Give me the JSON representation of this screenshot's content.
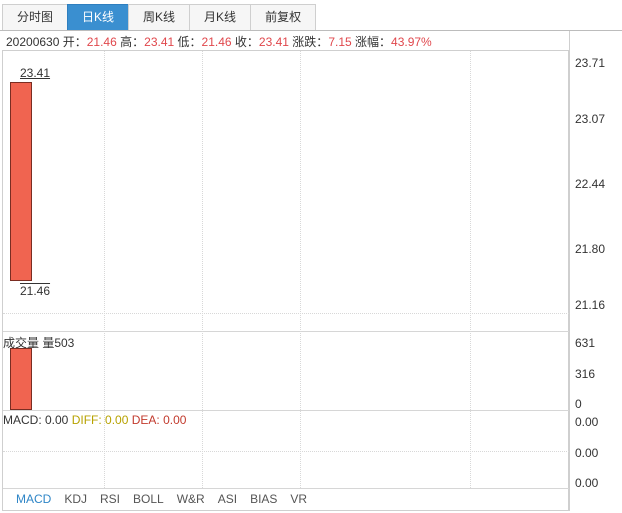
{
  "tabs": [
    "分时图",
    "日K线",
    "周K线",
    "月K线",
    "前复权"
  ],
  "active_tab_index": 1,
  "info": {
    "date": "20200630",
    "open_label": "开：",
    "open": "21.46",
    "high_label": "高：",
    "high": "23.41",
    "low_label": "低：",
    "low": "21.46",
    "close_label": "收：",
    "close": "23.41",
    "change_label": "涨跌：",
    "change": "7.15",
    "pct_label": "涨幅：",
    "pct": "43.97%"
  },
  "candle": {
    "high_label": "23.41",
    "low_label": "21.46"
  },
  "price_axis": [
    "23.71",
    "23.07",
    "22.44",
    "21.80",
    "21.16"
  ],
  "volume": {
    "title": "成交量 量503",
    "axis": [
      "631",
      "316",
      "0"
    ]
  },
  "macd": {
    "macd_text": "MACD: 0.00",
    "diff_text": "DIFF: 0.00",
    "dea_text": "DEA: 0.00",
    "axis": [
      "0.00",
      "0.00",
      "0.00"
    ]
  },
  "indicator_tabs": [
    "MACD",
    "KDJ",
    "RSI",
    "BOLL",
    "W&R",
    "ASI",
    "BIAS",
    "VR"
  ],
  "active_indicator_index": 0,
  "colors": {
    "up": "#f06450",
    "accent": "#3a8fd0",
    "diff": "#b7a200",
    "dea": "#c23a2d"
  }
}
